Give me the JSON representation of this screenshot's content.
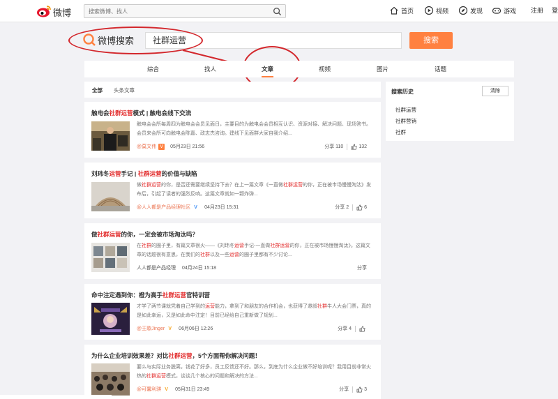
{
  "topbar": {
    "logo_text": "微博",
    "search_placeholder": "搜索微博、找人",
    "nav": [
      {
        "label": "首页",
        "icon": "home-icon"
      },
      {
        "label": "视频",
        "icon": "video-icon"
      },
      {
        "label": "发现",
        "icon": "compass-icon"
      },
      {
        "label": "游戏",
        "icon": "gamepad-icon"
      },
      {
        "label": "注册",
        "icon": ""
      },
      {
        "label": "登",
        "icon": ""
      }
    ]
  },
  "search": {
    "logo_text": "微博搜索",
    "query": "社群运营",
    "button_label": "搜索"
  },
  "tabs": [
    {
      "label": "综合",
      "active": false
    },
    {
      "label": "找人",
      "active": false
    },
    {
      "label": "文章",
      "active": true
    },
    {
      "label": "视频",
      "active": false
    },
    {
      "label": "图片",
      "active": false
    },
    {
      "label": "话题",
      "active": false
    }
  ],
  "filters": {
    "all": "全部",
    "headline": "头条文章"
  },
  "articles": [
    {
      "title_parts": [
        "触电会",
        "社群",
        "运营",
        "模式 | 触电会线下交流"
      ],
      "desc": "触电会会所每周四为触电会会员见面日，主要目的为触电会会员相互认识、资源对接、解决问题、现场答书。会员来会所可向触电会陈嘉、政志杰咨询。建线下见面群大家自我介绍...",
      "author": "@莫文伟",
      "badge": "V",
      "time": "05月23日 21:56",
      "share": "分享 110",
      "likes": "132"
    },
    {
      "title_parts": [
        "刘玮冬",
        "运营",
        "手记 | ",
        "社群运营",
        "的价值与缺陷"
      ],
      "desc_parts": [
        "做",
        "社群运营",
        "的你，是否还需要继续坚持下去？在上一篇文章《一直做",
        "社群运营",
        "的你，正在被市场慢慢淘汰》发布后，引起了读者的强烈反响。这篇文章就如一颗炸弹...",
        ""
      ],
      "author": "@人人都是产品经理社区",
      "badge": "V",
      "time": "04月23日 15:31",
      "share": "分享 2",
      "likes": "6"
    },
    {
      "title_parts": [
        "做",
        "社群运营",
        "的你，一定会被市场淘汰吗？"
      ],
      "desc_parts": [
        "在",
        "社群",
        "的圈子里，有篇文章很火——《刘玮冬",
        "运营",
        "手记-一直做",
        "社群运营",
        "的你，正在被市场慢慢淘汰》。这篇文章的话题很有意思，在我们的",
        "社群",
        "以及一些",
        "运营",
        "的圈子里都有不少讨论..."
      ],
      "author": "人人都是产品经理",
      "time": "04月24日 15:18",
      "share": "分享",
      "likes": ""
    },
    {
      "title_parts": [
        "命中注定遇到你：橙为高手",
        "社群运营",
        "官特训营"
      ],
      "desc_parts": [
        "才学了两节课就凭着自己学到的",
        "运营",
        "能力，拿到了和朋友的合作机会，也获得了邀叔",
        "社群",
        "牛人大会门票，真的是如此幸运，又是如此命中注定！目前已经给自己重新做了规划..."
      ],
      "author": "@王歌Jinger",
      "badge": "V",
      "time": "06月06日 12:26",
      "share": "分享 4",
      "likes": ""
    },
    {
      "title_parts": [
        "为什么企业培训效果差？对比",
        "社群运营",
        "，5个方面帮你解决问题！"
      ],
      "desc_parts": [
        "要么与实际业务脱离，钱花了好多，员工反馈还不好。那么，到底为什么企业做不好培训呢？我用目前非常火热的",
        "社群运营",
        "模式，谈谈几个核心的问题和解决的方法..."
      ],
      "author": "@可馨利骐",
      "badge": "V",
      "time": "05月31日 23:49",
      "share": "分享",
      "likes": "3"
    }
  ],
  "sidebar": {
    "title": "搜索历史",
    "clear_label": "清除",
    "history": [
      "社群运营",
      "社群营销",
      "社群"
    ]
  }
}
